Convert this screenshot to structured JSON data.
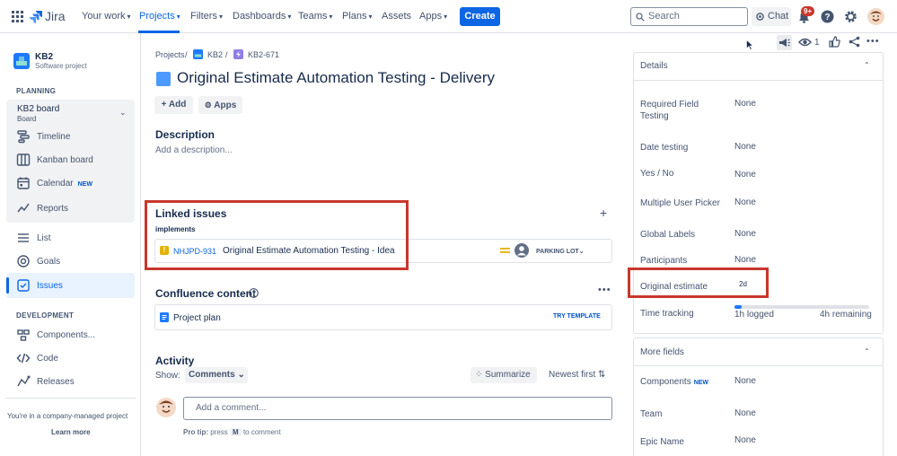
{
  "nav": {
    "logo_text": "Jira",
    "items": [
      "Your work",
      "Projects",
      "Filters",
      "Dashboards",
      "Teams",
      "Plans",
      "Assets",
      "Apps"
    ],
    "create_label": "Create",
    "search_placeholder": "Search",
    "chat_label": "Chat",
    "notif_badge": "9+"
  },
  "sidebar": {
    "project_name": "KB2",
    "project_type": "Software project",
    "planning_heading": "PLANNING",
    "board_name": "KB2 board",
    "board_sub": "Board",
    "planning_items": [
      "Timeline",
      "Kanban board",
      "Calendar",
      "Reports"
    ],
    "calendar_tag": "NEW",
    "other_items": [
      "List",
      "Goals",
      "Issues"
    ],
    "development_heading": "DEVELOPMENT",
    "dev_items": [
      "Components...",
      "Code",
      "Releases"
    ],
    "footer_text": "You're in a company-managed project",
    "learn_more": "Learn more"
  },
  "main": {
    "breadcrumb": [
      "Projects",
      "KB2",
      "KB2-671"
    ],
    "title": "Original Estimate Automation Testing - Delivery",
    "add_label": "Add",
    "apps_label": "Apps",
    "description_heading": "Description",
    "description_placeholder": "Add a description...",
    "linked_heading": "Linked issues",
    "link_type": "implements",
    "linked_issue": {
      "key": "NHJPD-931",
      "summary": "Original Estimate Automation Testing - Idea",
      "status": "PARKING LOT"
    },
    "confluence_heading": "Confluence content",
    "confluence_item": "Project plan",
    "try_template": "TRY TEMPLATE",
    "activity_heading": "Activity",
    "show_label": "Show:",
    "comments_label": "Comments",
    "summarize_label": "Summarize",
    "newest_first_label": "Newest first",
    "comment_placeholder": "Add a comment...",
    "pro_tip_prefix": "Pro tip:",
    "pro_tip_press": "press",
    "pro_tip_key": "M",
    "pro_tip_suffix": "to comment"
  },
  "right": {
    "watch_count": "1",
    "details_heading": "Details",
    "fields": [
      {
        "label": "Required Field Testing",
        "value": "None"
      },
      {
        "label": "Date testing",
        "value": "None"
      },
      {
        "label": "Yes / No",
        "value": "None"
      },
      {
        "label": "Multiple User Picker",
        "value": "None"
      },
      {
        "label": "Global Labels",
        "value": "None"
      },
      {
        "label": "Participants",
        "value": "None"
      },
      {
        "label": "Original estimate",
        "value": "2d"
      },
      {
        "label": "Time tracking",
        "value": ""
      }
    ],
    "time_logged": "1h logged",
    "time_remaining": "4h remaining",
    "time_progress": 0.05,
    "more_fields_heading": "More fields",
    "more_fields": [
      {
        "label": "Components",
        "value": "None",
        "tag": "NEW"
      },
      {
        "label": "Team",
        "value": "None"
      },
      {
        "label": "Epic Name",
        "value": "None"
      }
    ]
  }
}
